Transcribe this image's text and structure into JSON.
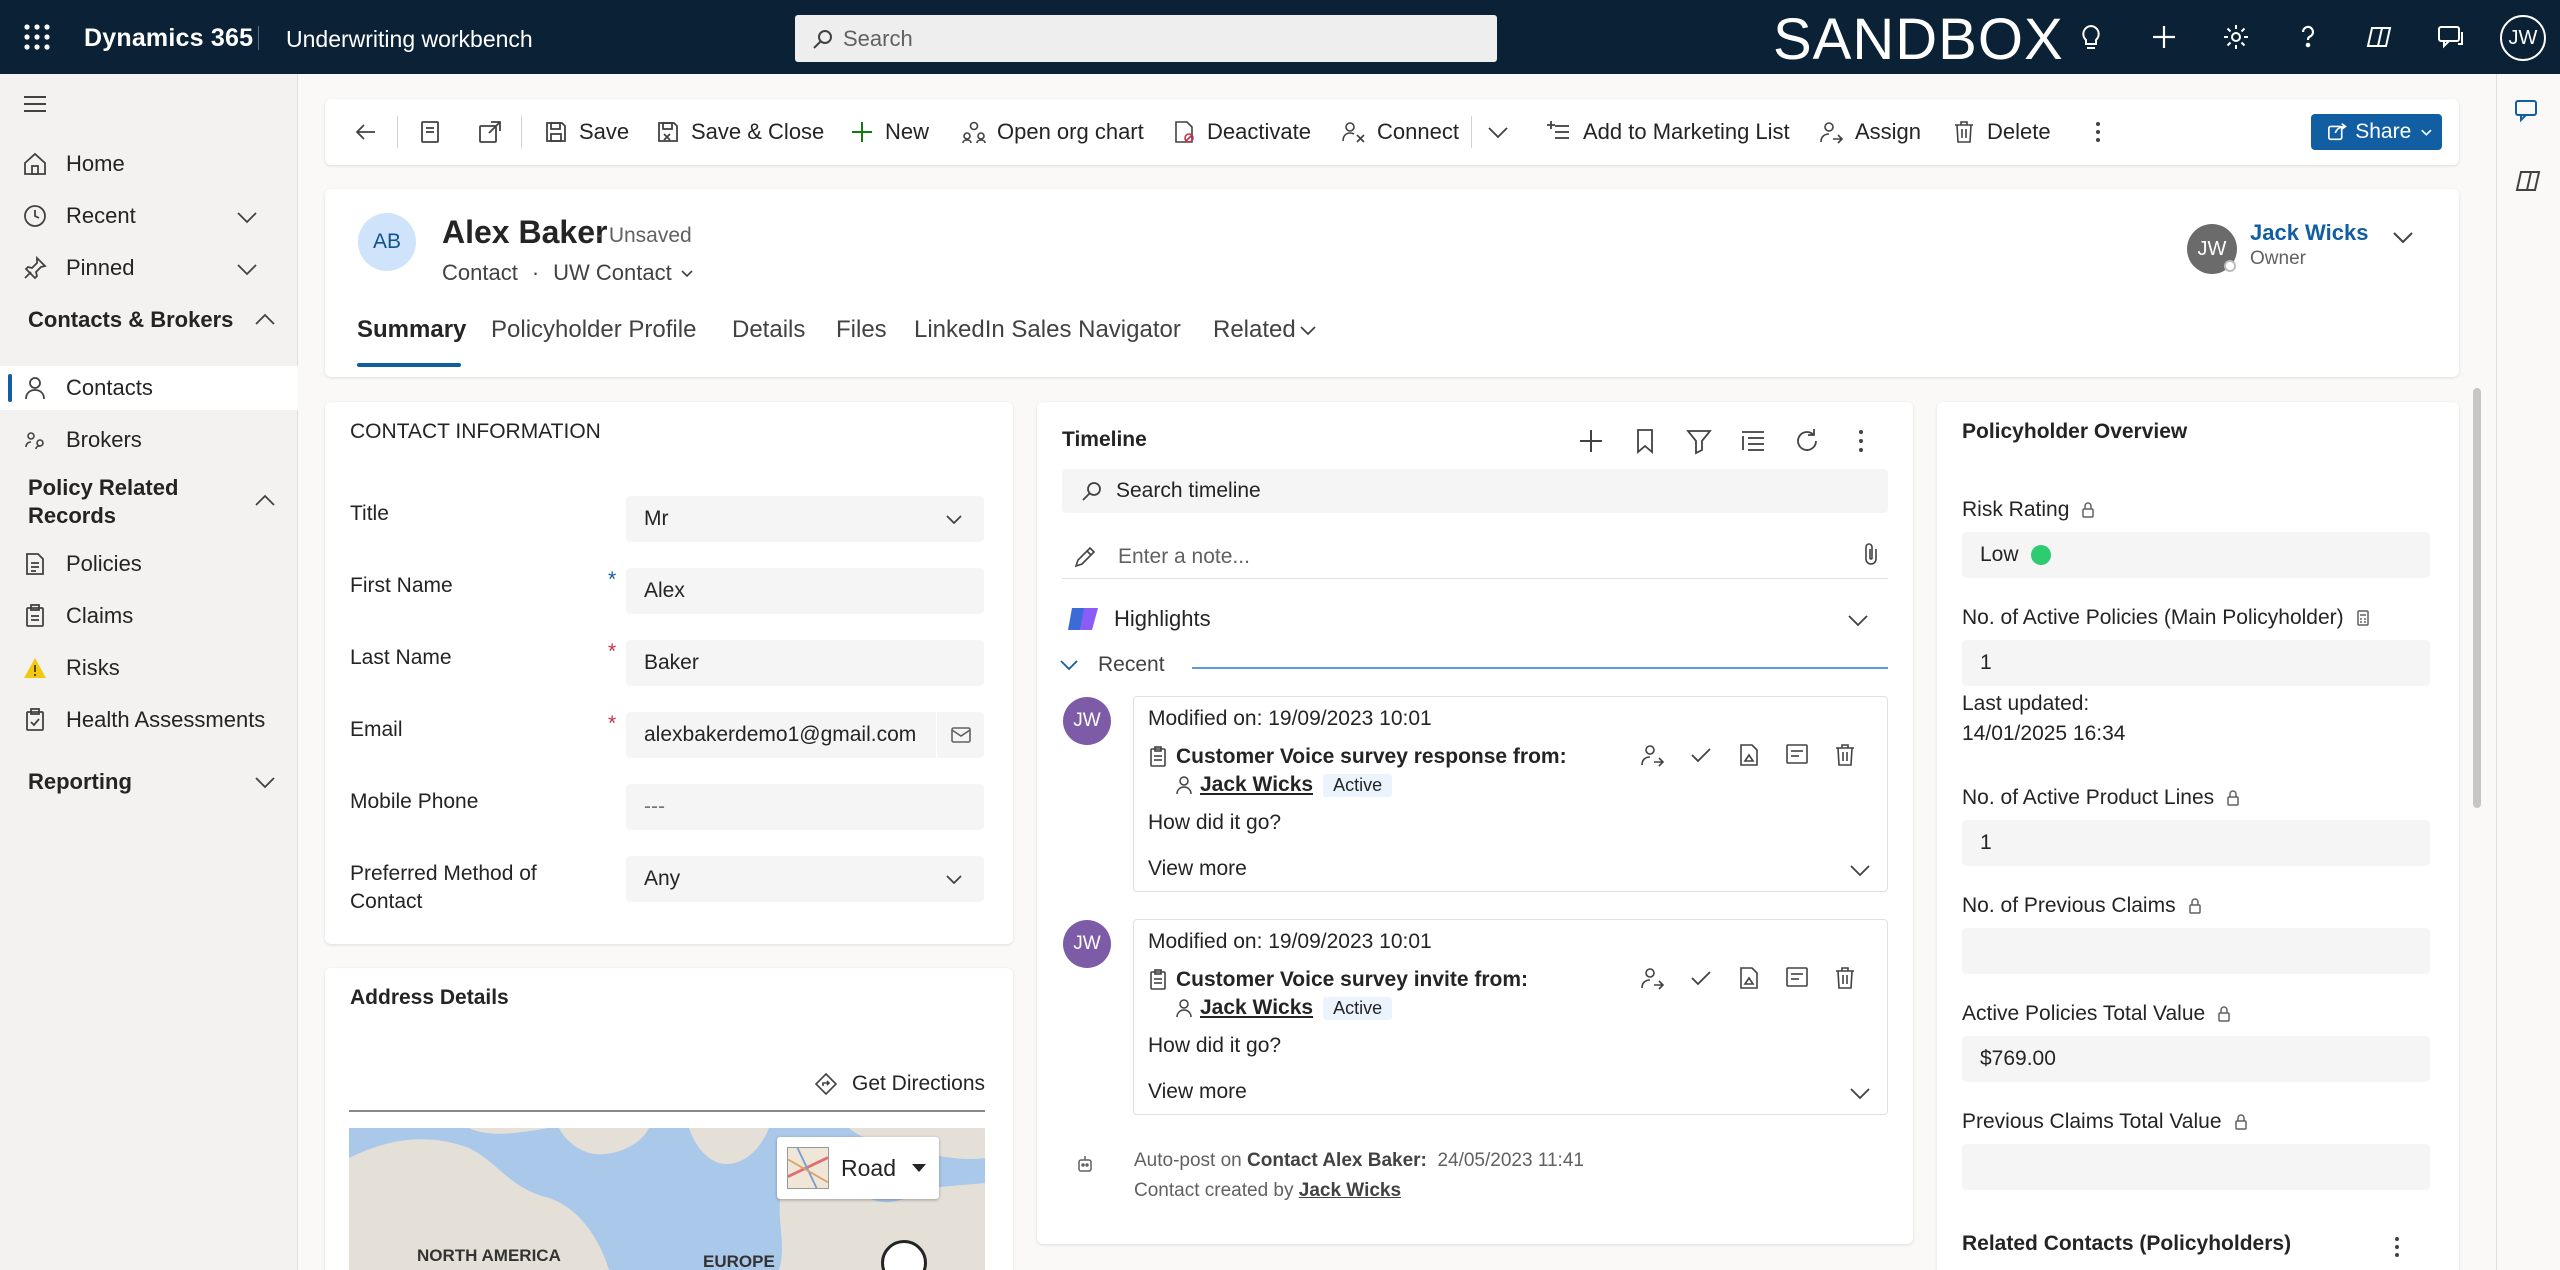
{
  "topbar": {
    "brand": "Dynamics 365",
    "app_name": "Underwriting workbench",
    "search_placeholder": "Search",
    "environment": "SANDBOX",
    "user_initials": "JW"
  },
  "nav": {
    "home": "Home",
    "recent": "Recent",
    "pinned": "Pinned",
    "group_contacts": "Contacts & Brokers",
    "contacts": "Contacts",
    "brokers": "Brokers",
    "group_policy": "Policy Related Records",
    "policies": "Policies",
    "claims": "Claims",
    "risks": "Risks",
    "health": "Health Assessments",
    "group_reporting": "Reporting"
  },
  "commands": {
    "save": "Save",
    "save_close": "Save & Close",
    "new": "New",
    "org_chart": "Open org chart",
    "deactivate": "Deactivate",
    "connect": "Connect",
    "marketing": "Add to Marketing List",
    "assign": "Assign",
    "delete": "Delete",
    "share": "Share"
  },
  "record": {
    "initials": "AB",
    "name": "Alex Baker",
    "status": "- Unsaved",
    "entity": "Contact",
    "separator": "·",
    "form": "UW Contact",
    "owner_initials": "JW",
    "owner_name": "Jack Wicks",
    "owner_role": "Owner"
  },
  "tabs": [
    "Summary",
    "Policyholder Profile",
    "Details",
    "Files",
    "LinkedIn Sales Navigator",
    "Related"
  ],
  "contact_info": {
    "title": "CONTACT INFORMATION",
    "fields": [
      {
        "label": "Title",
        "value": "Mr"
      },
      {
        "label": "First Name",
        "value": "Alex"
      },
      {
        "label": "Last Name",
        "value": "Baker"
      },
      {
        "label": "Email",
        "value": "alexbakerdemo1@gmail.com"
      },
      {
        "label": "Mobile Phone",
        "value": "---"
      },
      {
        "label": "Preferred Method of Contact",
        "value": "Any"
      }
    ]
  },
  "address": {
    "title": "Address Details",
    "directions": "Get Directions",
    "map_type": "Road",
    "map_labels": [
      "NORTH AMERICA",
      "EUROPE"
    ]
  },
  "timeline": {
    "title": "Timeline",
    "search_placeholder": "Search timeline",
    "note_placeholder": "Enter a note...",
    "highlights": "Highlights",
    "recent": "Recent",
    "posts": [
      {
        "initials": "JW",
        "modified": "Modified on: 19/09/2023 10:01",
        "title": "Customer Voice survey response from:",
        "author": "Jack Wicks",
        "badge": "Active",
        "body": "How did it go?",
        "view_more": "View more"
      },
      {
        "initials": "JW",
        "modified": "Modified on: 19/09/2023 10:01",
        "title": "Customer Voice survey invite from:",
        "author": "Jack Wicks",
        "badge": "Active",
        "body": "How did it go?",
        "view_more": "View more"
      }
    ],
    "autopost": {
      "prefix": "Auto-post on",
      "entity": "Contact Alex Baker:",
      "date": "24/05/2023 11:41",
      "line2_prefix": "Contact created by",
      "line2_user": "Jack Wicks"
    }
  },
  "overview": {
    "title": "Policyholder Overview",
    "risk_label": "Risk Rating",
    "risk_value": "Low",
    "risk_color": "#2ecc71",
    "active_policies_label": "No. of Active Policies (Main Policyholder)",
    "active_policies_value": "1",
    "last_updated_label": "Last updated:",
    "last_updated_value": "14/01/2025 16:34",
    "product_lines_label": "No. of Active Product Lines",
    "product_lines_value": "1",
    "prev_claims_label": "No. of Previous Claims",
    "prev_claims_value": "",
    "policies_total_label": "Active Policies Total Value",
    "policies_total_value": "$769.00",
    "claims_total_label": "Previous Claims Total Value",
    "claims_total_value": "",
    "related_contacts": "Related Contacts (Policyholders)"
  }
}
